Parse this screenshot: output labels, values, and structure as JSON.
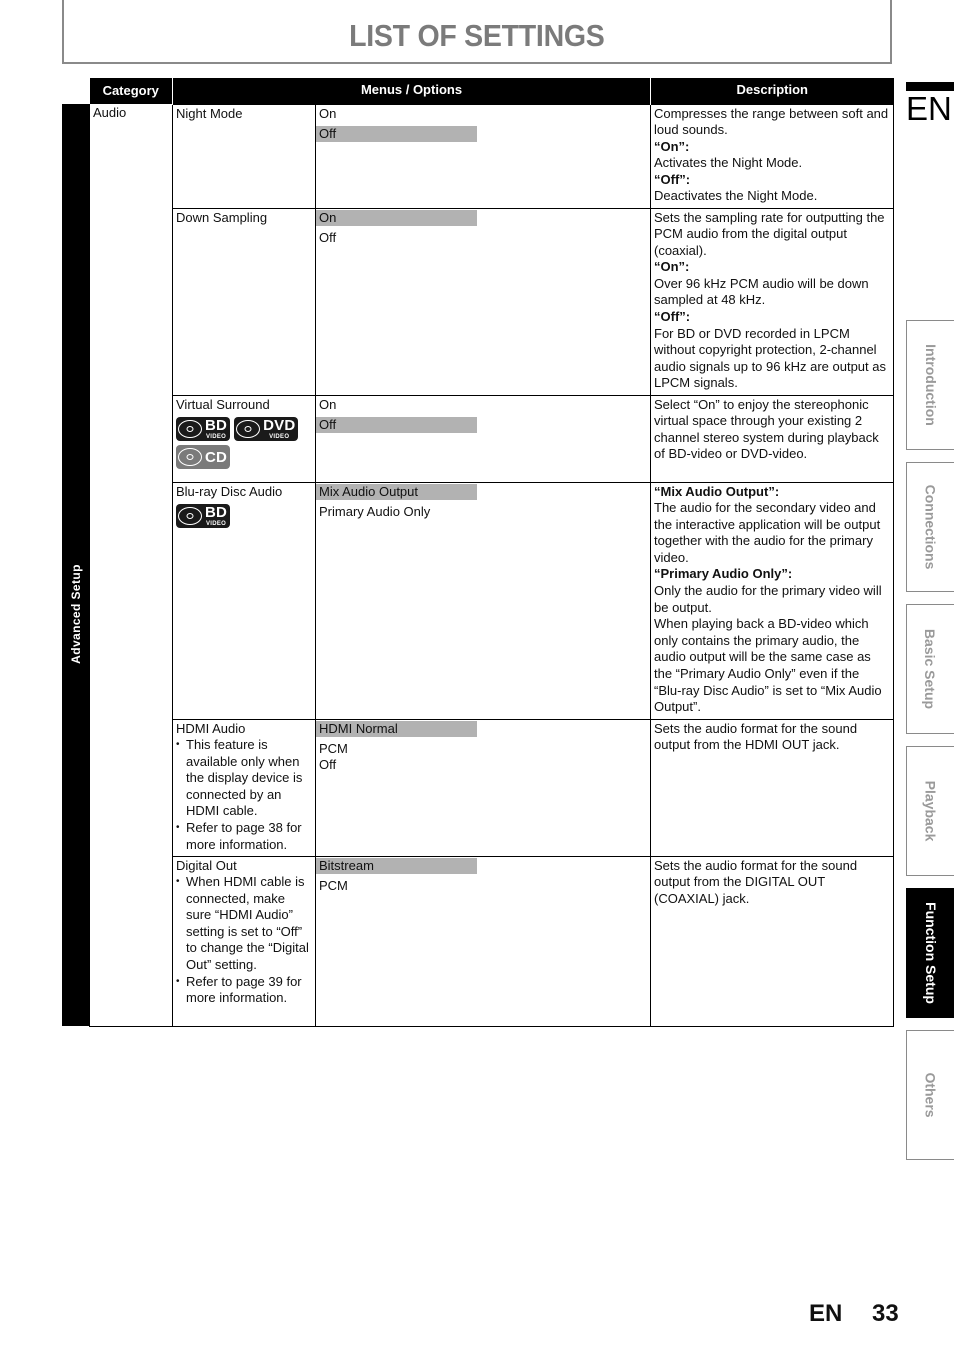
{
  "page_title": "LIST OF SETTINGS",
  "side_category": "Advanced Setup",
  "table": {
    "headers": {
      "category": "Category",
      "menus": "Menus / Options",
      "description": "Description"
    },
    "category_label": "Audio",
    "rows": [
      {
        "menu": "Night Mode",
        "notes": [],
        "discs": [],
        "options": [
          {
            "label": "On",
            "selected": false
          },
          {
            "label": "Off",
            "selected": true
          }
        ],
        "description": [
          {
            "text": "Compresses the range between soft and loud sounds.",
            "bold": false
          },
          {
            "text": "“On”:",
            "bold": true
          },
          {
            "text": "Activates the Night Mode.",
            "bold": false
          },
          {
            "text": "“Off”:",
            "bold": true
          },
          {
            "text": "Deactivates the Night Mode.",
            "bold": false
          }
        ]
      },
      {
        "menu": "Down Sampling",
        "notes": [],
        "discs": [],
        "options": [
          {
            "label": "On",
            "selected": true
          },
          {
            "label": "Off",
            "selected": false
          }
        ],
        "description": [
          {
            "text": "Sets the sampling rate for outputting the PCM audio from the digital output (coaxial).",
            "bold": false
          },
          {
            "text": "“On”:",
            "bold": true
          },
          {
            "text": "Over 96 kHz PCM audio will be down sampled at 48 kHz.",
            "bold": false
          },
          {
            "text": "“Off”:",
            "bold": true
          },
          {
            "text": "For BD or DVD recorded in LPCM without copyright protection, 2-channel audio signals up to 96 kHz are output as LPCM signals.",
            "bold": false
          }
        ]
      },
      {
        "menu": "Virtual Surround",
        "notes": [],
        "discs": [
          [
            {
              "name": "bd-video-icon",
              "big": "BD",
              "small": "VIDEO",
              "type": "dark"
            },
            {
              "name": "dvd-video-icon",
              "big": "DVD",
              "small": "VIDEO",
              "type": "dark"
            }
          ],
          [
            {
              "name": "cd-icon",
              "big": "CD",
              "small": "",
              "type": "cd"
            }
          ]
        ],
        "options": [
          {
            "label": "On",
            "selected": false
          },
          {
            "label": "Off",
            "selected": true
          }
        ],
        "description": [
          {
            "text": "Select “On” to enjoy the stereophonic virtual space through your existing 2 channel stereo system during playback of BD-video or DVD-video.",
            "bold": false
          }
        ]
      },
      {
        "menu": "Blu-ray Disc Audio",
        "notes": [],
        "discs": [
          [
            {
              "name": "bd-video-icon",
              "big": "BD",
              "small": "VIDEO",
              "type": "dark"
            }
          ]
        ],
        "options": [
          {
            "label": "Mix Audio Output",
            "selected": true
          },
          {
            "label": "Primary Audio Only",
            "selected": false
          }
        ],
        "description": [
          {
            "text": "“Mix Audio Output”:",
            "bold": true
          },
          {
            "text": "The audio for the secondary video and the interactive application will be output together with the audio for the primary video.",
            "bold": false
          },
          {
            "text": "“Primary Audio Only”:",
            "bold": true
          },
          {
            "text": "Only the audio for the primary video will be output.",
            "bold": false
          },
          {
            "text": "When playing back a BD-video which only contains the primary audio, the audio output will be the same case as the “Primary Audio Only” even if the “Blu-ray Disc Audio” is set to “Mix Audio Output”.",
            "bold": false
          }
        ]
      },
      {
        "menu": "HDMI Audio",
        "notes": [
          "This feature is available only when the display device is connected by an HDMI cable.",
          "Refer to page 38 for more information."
        ],
        "discs": [],
        "options": [
          {
            "label": "HDMI Normal",
            "selected": true
          },
          {
            "label": "PCM",
            "selected": false
          },
          {
            "label": "Off",
            "selected": false
          }
        ],
        "description": [
          {
            "text": "Sets the audio format for the sound output from the HDMI OUT jack.",
            "bold": false
          }
        ]
      },
      {
        "menu": "Digital Out",
        "notes": [
          "When HDMI cable is connected, make sure “HDMI Audio” setting is set to “Off” to change the “Digital Out” setting.",
          "Refer to page 39 for more information."
        ],
        "discs": [],
        "options": [
          {
            "label": "Bitstream",
            "selected": true
          },
          {
            "label": "PCM",
            "selected": false
          }
        ],
        "description": [
          {
            "text": "Sets the audio format for the sound output from the DIGITAL OUT (COAXIAL) jack.",
            "bold": false
          }
        ]
      }
    ]
  },
  "side_nav": {
    "language": "EN",
    "tabs": [
      {
        "label": "Introduction",
        "active": false
      },
      {
        "label": "Connections",
        "active": false
      },
      {
        "label": "Basic Setup",
        "active": false
      },
      {
        "label": "Playback",
        "active": false
      },
      {
        "label": "Function Setup",
        "active": true
      },
      {
        "label": "Others",
        "active": false
      }
    ]
  },
  "footer": {
    "language": "EN",
    "page_number": "33"
  }
}
